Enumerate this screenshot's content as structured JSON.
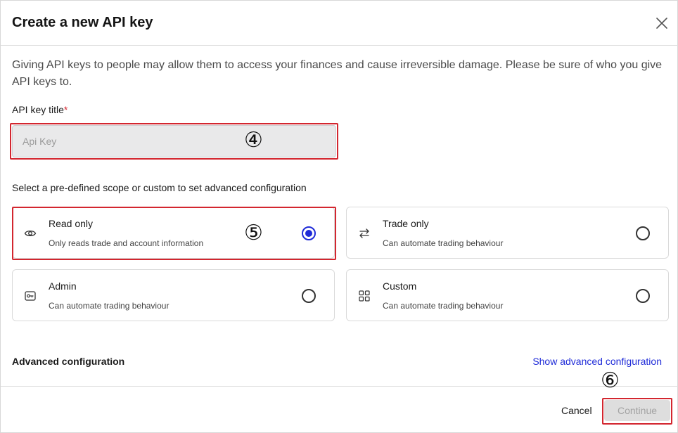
{
  "dialog": {
    "title": "Create a new API key",
    "warning": "Giving API keys to people may allow them to access your finances and cause irreversible damage. Please be sure of who you give API keys to."
  },
  "form": {
    "title_label": "API key title",
    "required_mark": "*",
    "title_placeholder": "Api Key",
    "scope_prompt": "Select a pre-defined scope or custom to set advanced configuration"
  },
  "scopes": [
    {
      "title": "Read only",
      "description": "Only reads trade and account information",
      "icon": "eye-icon",
      "selected": true
    },
    {
      "title": "Trade only",
      "description": "Can automate trading behaviour",
      "icon": "swap-arrows-icon",
      "selected": false
    },
    {
      "title": "Admin",
      "description": "Can automate trading behaviour",
      "icon": "key-icon",
      "selected": false
    },
    {
      "title": "Custom",
      "description": "Can automate trading behaviour",
      "icon": "grid-icon",
      "selected": false
    }
  ],
  "advanced": {
    "label": "Advanced configuration",
    "link": "Show advanced configuration"
  },
  "footer": {
    "cancel": "Cancel",
    "continue": "Continue"
  },
  "annotations": [
    "④",
    "⑤",
    "⑥"
  ],
  "colors": {
    "accent": "#1f2bd8",
    "annotation": "#d3262f",
    "required": "#d3262f"
  }
}
